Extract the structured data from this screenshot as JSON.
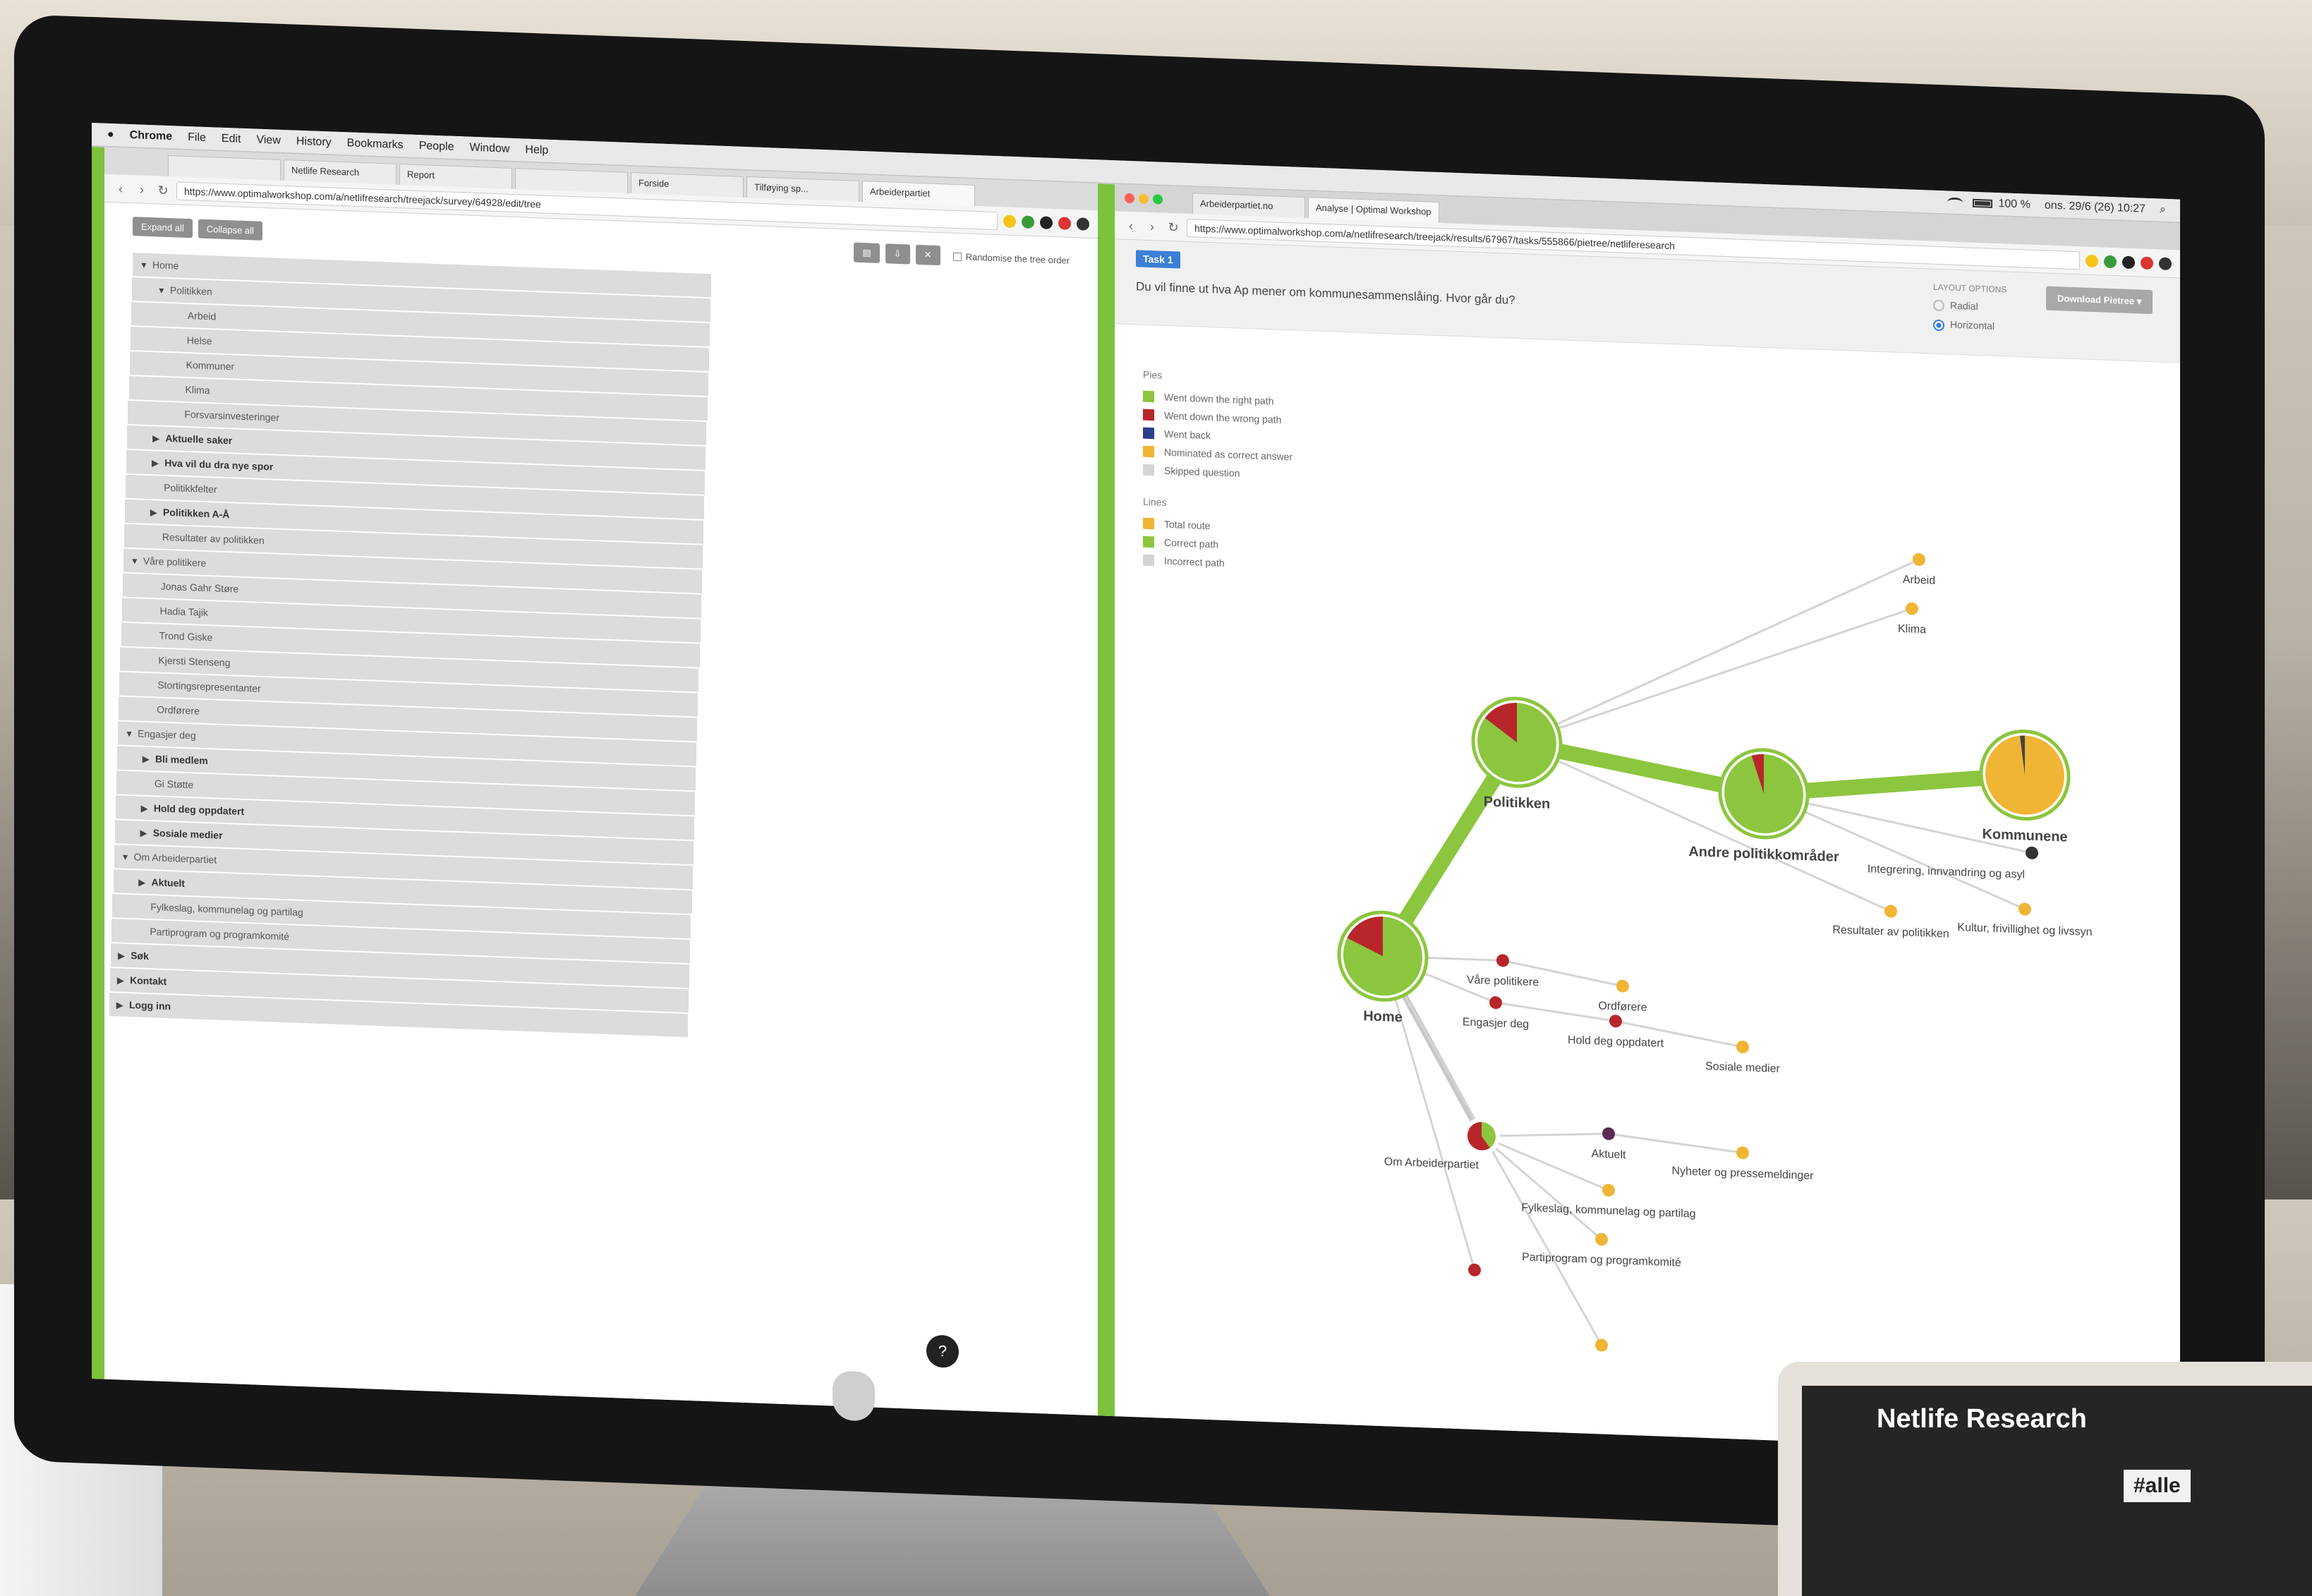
{
  "os_menu": {
    "items": [
      "Chrome",
      "File",
      "Edit",
      "View",
      "History",
      "Bookmarks",
      "People",
      "Window",
      "Help"
    ],
    "status": "ons. 29/6 (26) 10:27",
    "battery": "100 %"
  },
  "left_browser": {
    "tabs": [
      "",
      "Netlife Research",
      "Report",
      "",
      "Forside",
      "Tilføying sp...",
      "Arbeiderpartiet"
    ],
    "url": "https://www.optimalworkshop.com/a/netlifresearch/treejack/survey/64928/edit/tree",
    "toolbar": {
      "expand_all": "Expand all",
      "collapse_all": "Collapse all",
      "randomise": "Randomise the tree order"
    },
    "tree": [
      {
        "label": "Home",
        "caret": "▼",
        "indent": 0
      },
      {
        "label": "Politikken",
        "caret": "▼",
        "indent": 1
      },
      {
        "label": "Arbeid",
        "caret": "",
        "indent": 2
      },
      {
        "label": "Helse",
        "caret": "",
        "indent": 2
      },
      {
        "label": "Kommuner",
        "caret": "",
        "indent": 2
      },
      {
        "label": "Klima",
        "caret": "",
        "indent": 2
      },
      {
        "label": "Forsvarsinvesteringer",
        "caret": "",
        "indent": 2
      },
      {
        "label": "Aktuelle saker",
        "caret": "▶",
        "indent": 1
      },
      {
        "label": "Hva vil du dra nye spor",
        "caret": "▶",
        "indent": 1
      },
      {
        "label": "Politikkfelter",
        "caret": "",
        "indent": 1
      },
      {
        "label": "Politikken A-Å",
        "caret": "▶",
        "indent": 1
      },
      {
        "label": "Resultater av politikken",
        "caret": "",
        "indent": 1
      },
      {
        "label": "Våre politikere",
        "caret": "▼",
        "indent": 0
      },
      {
        "label": "Jonas Gahr Støre",
        "caret": "",
        "indent": 1
      },
      {
        "label": "Hadia Tajik",
        "caret": "",
        "indent": 1
      },
      {
        "label": "Trond Giske",
        "caret": "",
        "indent": 1
      },
      {
        "label": "Kjersti Stenseng",
        "caret": "",
        "indent": 1
      },
      {
        "label": "Stortingsrepresentanter",
        "caret": "",
        "indent": 1
      },
      {
        "label": "Ordførere",
        "caret": "",
        "indent": 1
      },
      {
        "label": "Engasjer deg",
        "caret": "▼",
        "indent": 0
      },
      {
        "label": "Bli medlem",
        "caret": "▶",
        "indent": 1
      },
      {
        "label": "Gi Støtte",
        "caret": "",
        "indent": 1
      },
      {
        "label": "Hold deg oppdatert",
        "caret": "▶",
        "indent": 1
      },
      {
        "label": "Sosiale medier",
        "caret": "▶",
        "indent": 1
      },
      {
        "label": "Om Arbeiderpartiet",
        "caret": "▼",
        "indent": 0
      },
      {
        "label": "Aktuelt",
        "caret": "▶",
        "indent": 1
      },
      {
        "label": "Fylkeslag, kommunelag og partilag",
        "caret": "",
        "indent": 1
      },
      {
        "label": "Partiprogram og programkomité",
        "caret": "",
        "indent": 1
      },
      {
        "label": "Søk",
        "caret": "▶",
        "indent": 0
      },
      {
        "label": "Kontakt",
        "caret": "▶",
        "indent": 0
      },
      {
        "label": "Logg inn",
        "caret": "▶",
        "indent": 0
      }
    ]
  },
  "right_browser": {
    "tabs": [
      "Arbeiderpartiet.no",
      "Analyse | Optimal Workshop"
    ],
    "url": "https://www.optimalworkshop.com/a/netlifresearch/treejack/results/67967/tasks/555866/pietree/netliferesearch",
    "task_badge": "Task 1",
    "task_question": "Du vil finne ut hva Ap mener om kommunesammenslåing. Hvor går du?",
    "layout_options": {
      "title": "LAYOUT OPTIONS",
      "radial": "Radial",
      "horizontal": "Horizontal"
    },
    "download_label": "Download Pietree ▾",
    "legend": {
      "pies_title": "Pies",
      "pies": [
        {
          "label": "Went down the right path",
          "color": "#8cc63f"
        },
        {
          "label": "Went down the wrong path",
          "color": "#b8262b"
        },
        {
          "label": "Went back",
          "color": "#2c3e8c"
        },
        {
          "label": "Nominated as correct answer",
          "color": "#f0b535"
        },
        {
          "label": "Skipped question",
          "color": "#d4d4d4"
        }
      ],
      "lines_title": "Lines",
      "lines": [
        {
          "label": "Total route",
          "color": "#f0b535"
        },
        {
          "label": "Correct path",
          "color": "#8cc63f"
        },
        {
          "label": "Incorrect path",
          "color": "#d4d4d4"
        }
      ]
    }
  },
  "pietree": {
    "nodes": [
      {
        "id": "home",
        "label": "Home",
        "kind": "pie",
        "size": "large",
        "wrong_fraction": 0.18
      },
      {
        "id": "politikken",
        "label": "Politikken",
        "kind": "pie",
        "size": "large",
        "wrong_fraction": 0.15
      },
      {
        "id": "andre",
        "label": "Andre politikkområder",
        "kind": "pie",
        "size": "large",
        "wrong_fraction": 0.05
      },
      {
        "id": "kommunene",
        "label": "Kommunene",
        "kind": "pie",
        "size": "large",
        "wrong_fraction": 0.02,
        "nominated": true
      },
      {
        "id": "arbeid",
        "label": "Arbeid",
        "kind": "dot",
        "color": "#f0b535"
      },
      {
        "id": "klima",
        "label": "Klima",
        "kind": "dot",
        "color": "#f0b535"
      },
      {
        "id": "integrering",
        "label": "Integrering, innvandring og asyl",
        "kind": "dot",
        "color": "#333333"
      },
      {
        "id": "kultur",
        "label": "Kultur, frivillighet og livssyn",
        "kind": "dot",
        "color": "#f0b535"
      },
      {
        "id": "resultater",
        "label": "Resultater av politikken",
        "kind": "dot",
        "color": "#f0b535"
      },
      {
        "id": "vare",
        "label": "Våre politikere",
        "kind": "dot",
        "color": "#b8262b"
      },
      {
        "id": "ordforere",
        "label": "Ordførere",
        "kind": "dot",
        "color": "#f0b535"
      },
      {
        "id": "engasjer",
        "label": "Engasjer deg",
        "kind": "dot",
        "color": "#b8262b"
      },
      {
        "id": "hold",
        "label": "Hold deg oppdatert",
        "kind": "dot",
        "color": "#b8262b"
      },
      {
        "id": "sosiale",
        "label": "Sosiale medier",
        "kind": "dot",
        "color": "#f0b535"
      },
      {
        "id": "om",
        "label": "Om Arbeiderpartiet",
        "kind": "pie",
        "size": "small",
        "wrong_fraction": 0.6
      },
      {
        "id": "aktuelt",
        "label": "Aktuelt",
        "kind": "dot",
        "color": "#5a2a55"
      },
      {
        "id": "nyheter",
        "label": "Nyheter og pressemeldinger",
        "kind": "dot",
        "color": "#f0b535"
      },
      {
        "id": "fylkeslag",
        "label": "Fylkeslag, kommunelag og partilag",
        "kind": "dot",
        "color": "#f0b535"
      },
      {
        "id": "partiprogram",
        "label": "Partiprogram og programkomité",
        "kind": "dot",
        "color": "#f0b535"
      },
      {
        "id": "sok",
        "label": "",
        "kind": "dot",
        "color": "#b8262b"
      },
      {
        "id": "kontakt",
        "label": "",
        "kind": "dot",
        "color": "#f0b535"
      }
    ],
    "edges": [
      {
        "from": "home",
        "to": "politikken",
        "type": "correct"
      },
      {
        "from": "politikken",
        "to": "andre",
        "type": "correct"
      },
      {
        "from": "andre",
        "to": "kommunene",
        "type": "correct"
      },
      {
        "from": "politikken",
        "to": "arbeid",
        "type": "incorrect"
      },
      {
        "from": "politikken",
        "to": "klima",
        "type": "incorrect"
      },
      {
        "from": "politikken",
        "to": "resultater",
        "type": "incorrect"
      },
      {
        "from": "andre",
        "to": "integrering",
        "type": "incorrect"
      },
      {
        "from": "andre",
        "to": "kultur",
        "type": "incorrect"
      },
      {
        "from": "home",
        "to": "vare",
        "type": "incorrect"
      },
      {
        "from": "vare",
        "to": "ordforere",
        "type": "incorrect"
      },
      {
        "from": "home",
        "to": "engasjer",
        "type": "incorrect"
      },
      {
        "from": "engasjer",
        "to": "hold",
        "type": "incorrect"
      },
      {
        "from": "hold",
        "to": "sosiale",
        "type": "incorrect"
      },
      {
        "from": "home",
        "to": "om",
        "type": "incorrect-heavy"
      },
      {
        "from": "om",
        "to": "aktuelt",
        "type": "incorrect"
      },
      {
        "from": "aktuelt",
        "to": "nyheter",
        "type": "incorrect"
      },
      {
        "from": "om",
        "to": "fylkeslag",
        "type": "incorrect"
      },
      {
        "from": "om",
        "to": "partiprogram",
        "type": "incorrect"
      },
      {
        "from": "home",
        "to": "sok",
        "type": "incorrect"
      },
      {
        "from": "home",
        "to": "kontakt",
        "type": "incorrect"
      }
    ]
  },
  "laptop": {
    "app_title": "Netlife Research",
    "channel": "#alle"
  },
  "colors": {
    "correct_green": "#8cc63f",
    "wrong_red": "#b8262b",
    "nominated_orange": "#f0b535",
    "split_green": "#7cc23d"
  }
}
